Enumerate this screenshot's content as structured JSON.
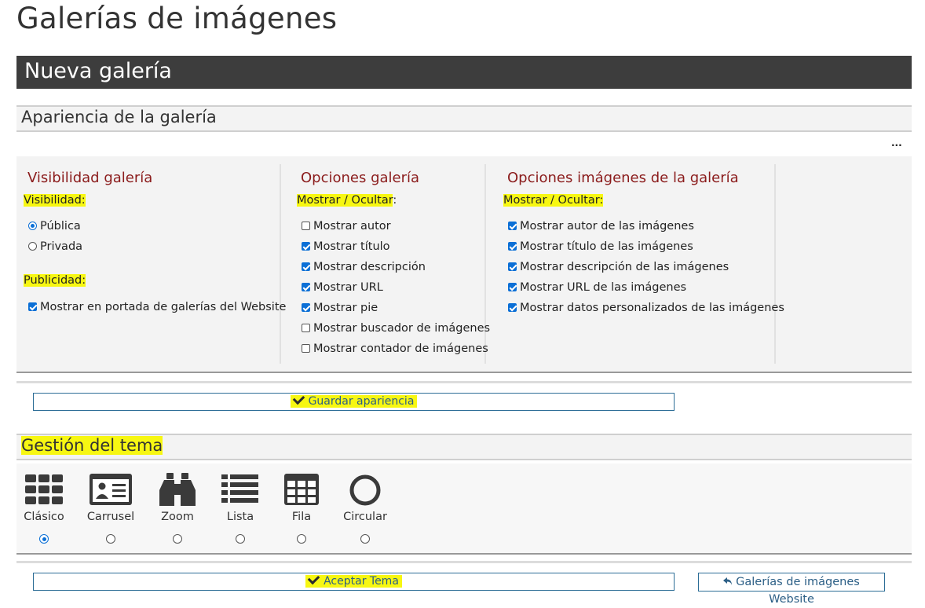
{
  "page": {
    "title": "Galerías de imágenes",
    "section_title": "Nueva galería",
    "ellipsis": "..."
  },
  "appearance": {
    "heading": "Apariencia de la galería",
    "visibility_column": {
      "title": "Visibilidad galería",
      "visibility_label": "Visibilidad:",
      "options": [
        {
          "label": "Pública",
          "selected": true
        },
        {
          "label": "Privada",
          "selected": false
        }
      ],
      "publicity_label": "Publicidad:",
      "publicity_option": {
        "label": "Mostrar en portada de galerías del Website",
        "checked": true
      }
    },
    "gallery_column": {
      "title": "Opciones galería",
      "show_hide_label": "Mostrar / Ocultar",
      "colon": ":",
      "options": [
        {
          "label": "Mostrar autor",
          "checked": false
        },
        {
          "label": "Mostrar título",
          "checked": true
        },
        {
          "label": "Mostrar descripción",
          "checked": true
        },
        {
          "label": "Mostrar URL",
          "checked": true
        },
        {
          "label": "Mostrar pie",
          "checked": true
        },
        {
          "label": "Mostrar buscador de imágenes",
          "checked": false
        },
        {
          "label": "Mostrar contador de imágenes",
          "checked": false
        }
      ]
    },
    "images_column": {
      "title": "Opciones imágenes de la galería",
      "show_hide_label": "Mostrar / Ocultar:",
      "options": [
        {
          "label": "Mostrar autor de las imágenes",
          "checked": true
        },
        {
          "label": "Mostrar título de las imágenes",
          "checked": true
        },
        {
          "label": "Mostrar descripción de las imágenes",
          "checked": true
        },
        {
          "label": "Mostrar URL de las imágenes",
          "checked": true
        },
        {
          "label": "Mostrar datos personalizados de las imágenes",
          "checked": true
        }
      ]
    },
    "save_button": "Guardar apariencia"
  },
  "theme": {
    "heading": "Gestión del tema",
    "options": [
      {
        "label": "Clásico",
        "icon": "grid-icon",
        "selected": true
      },
      {
        "label": "Carrusel",
        "icon": "id-card-icon",
        "selected": false
      },
      {
        "label": "Zoom",
        "icon": "binoculars-icon",
        "selected": false
      },
      {
        "label": "Lista",
        "icon": "list-icon",
        "selected": false
      },
      {
        "label": "Fila",
        "icon": "table-icon",
        "selected": false
      },
      {
        "label": "Circular",
        "icon": "circle-icon",
        "selected": false
      }
    ],
    "accept_button": "Aceptar Tema",
    "back_button": "Galerías de imágenes Website"
  },
  "colors": {
    "highlight": "#f7f712",
    "section_bar": "#3d3d3d",
    "column_title": "#8b1c1c",
    "checkbox": "#0b6fd6",
    "button_border": "#2c6d96"
  }
}
